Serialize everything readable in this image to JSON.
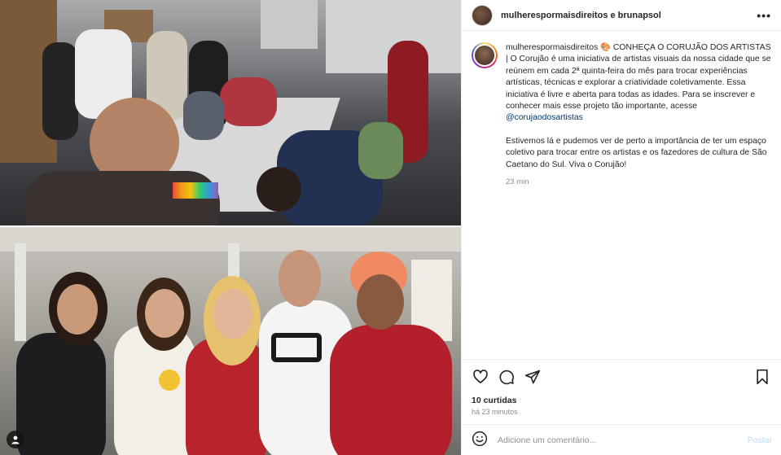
{
  "header": {
    "title": "mulherespormaisdireitos e brunapsol"
  },
  "caption": {
    "username": "mulherespormaisdireitos",
    "emoji": "🎨",
    "text1": " CONHEÇA O CORUJÃO DOS ARTISTAS | O Corujão é uma iniciativa de artistas visuais da nossa cidade que se reúnem em cada 2ª quinta-feira do mês para trocar experiências artísticas, técnicas e explorar a criatividade coletivamente. Essa iniciativa é livre e aberta para todas as idades. Para se inscrever e conhecer mais esse projeto tão importante, acesse ",
    "mention": "@corujaodosartistas",
    "text2": "Estivemos lá e pudemos ver de perto a importância de ter um espaço coletivo para trocar entre os artistas e os fazedores de cultura de São Caetano do Sul. Viva o Corujão!",
    "time": "23 min"
  },
  "actions": {
    "icons": [
      "heart-icon",
      "comment-icon",
      "share-icon",
      "bookmark-icon"
    ],
    "likes": "10 curtidas",
    "ago": "há 23 minutos"
  },
  "add_comment": {
    "placeholder": "Adicione um comentário...",
    "post_label": "Postar"
  },
  "colors": {
    "link": "#00376b",
    "muted": "#8e8e8e",
    "post_disabled": "#b2dffc"
  }
}
